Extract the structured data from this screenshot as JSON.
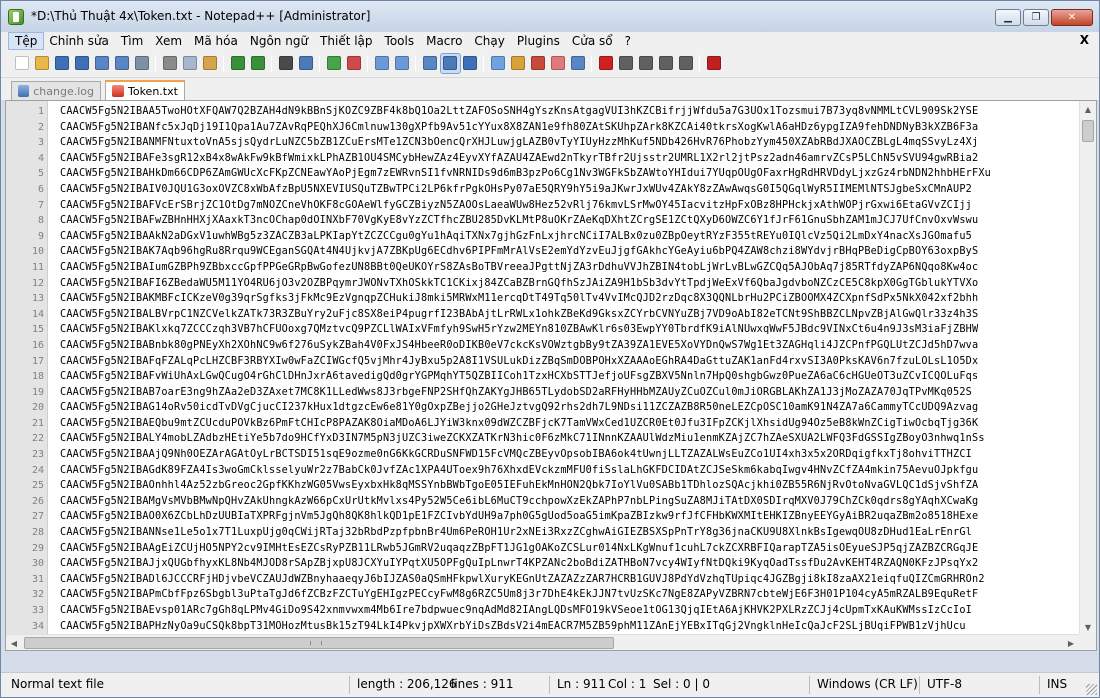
{
  "window": {
    "title": "*D:\\Thủ Thuật 4x\\Token.txt - Notepad++ [Administrator]",
    "buttons": [
      "▁",
      "❐",
      "✕"
    ]
  },
  "menu": {
    "items": [
      "Tệp",
      "Chỉnh sửa",
      "Tìm",
      "Xem",
      "Mã hóa",
      "Ngôn ngữ",
      "Thiết lập",
      "Tools",
      "Macro",
      "Chạy",
      "Plugins",
      "Cửa sổ",
      "?"
    ],
    "close": "X"
  },
  "toolbar": {
    "icons": [
      {
        "name": "new-file-icon",
        "color": "#ffffff"
      },
      {
        "name": "open-file-icon",
        "color": "#e8b84a"
      },
      {
        "name": "save-icon",
        "color": "#3f6fb6"
      },
      {
        "name": "save-all-icon",
        "color": "#3f6fb6"
      },
      {
        "name": "close-file-icon",
        "color": "#5b86c5"
      },
      {
        "name": "close-all-icon",
        "color": "#5b86c5"
      },
      {
        "name": "print-icon",
        "color": "#7f8fa6"
      },
      {
        "name": "cut-icon",
        "color": "#8a8a8a"
      },
      {
        "name": "copy-icon",
        "color": "#a6b6cf"
      },
      {
        "name": "paste-icon",
        "color": "#d7a44a"
      },
      {
        "name": "undo-icon",
        "color": "#3a8f3a"
      },
      {
        "name": "redo-icon",
        "color": "#3a8f3a"
      },
      {
        "name": "find-icon",
        "color": "#4a4a4a"
      },
      {
        "name": "replace-icon",
        "color": "#4a7ab8"
      },
      {
        "name": "zoom-in-icon",
        "color": "#4aa34a"
      },
      {
        "name": "zoom-out-icon",
        "color": "#d04a4a"
      },
      {
        "name": "sync-vertical-icon",
        "color": "#6d9ad6"
      },
      {
        "name": "sync-horizontal-icon",
        "color": "#6d9ad6"
      },
      {
        "name": "word-wrap-icon",
        "color": "#5b86c5"
      },
      {
        "name": "show-all-chars-icon",
        "color": "#4a7ab8"
      },
      {
        "name": "indent-guide-icon",
        "color": "#3f6fb6"
      },
      {
        "name": "document-map-icon",
        "color": "#6fa2e0"
      },
      {
        "name": "function-list-icon",
        "color": "#d8a23a"
      },
      {
        "name": "folder-workspace-icon",
        "color": "#c84a3a"
      },
      {
        "name": "monitoring-icon",
        "color": "#e07a7a"
      },
      {
        "name": "eye-icon",
        "color": "#5b86c5"
      },
      {
        "name": "record-macro-icon",
        "color": "#d02020"
      },
      {
        "name": "stop-recording-icon",
        "color": "#606060"
      },
      {
        "name": "play-macro-icon",
        "color": "#606060"
      },
      {
        "name": "run-macro-multiple-icon",
        "color": "#606060"
      },
      {
        "name": "save-macro-icon",
        "color": "#606060"
      },
      {
        "name": "spell-check-icon",
        "color": "#c02020"
      }
    ]
  },
  "tabs": [
    {
      "label": "change.log",
      "active": false
    },
    {
      "label": "Token.txt",
      "active": true
    }
  ],
  "editor": {
    "lines": [
      {
        "n": "1",
        "text": "CAACW5Fg5N2IBAA5TwoHOtXFQAW7Q2BZAH4dN9kBBnSjKOZC9ZBF4k8bQ1Oa2LttZAFOSoSNH4gYszKnsAtgagVUI3hKZCBifrjjWfdu5a7G3UOx1Tozsmui7B73yq8vNMMLtCVL909Sk2YSE"
      },
      {
        "n": "2",
        "text": "CAACW5Fg5N2IBANfc5xJqDj19I1Qpa1Au7ZAvRqPEQhXJ6Cmlnuw130gXPfb9Av51cYYux8X8ZAN1e9fh80ZAtSKUhpZArk8KZCAi40tkrsXogKwlA6aHDz6ypgIZA9fehDNDNyB3kXZB6F3a"
      },
      {
        "n": "3",
        "text": "CAACW5Fg5N2IBANMFNtuxtoVnA5sjsQydrLuNZC5bZB1ZCuErsMTe1ZCN3bOencQrXHJLuwjgLAZB0vTyYIUyHzzMhKuf5NDb426HvR76PhobzYym450XZAbRBdJXAOCZBLgL4mqSSvyLz4Xj"
      },
      {
        "n": "4",
        "text": "CAACW5Fg5N2IBAFe3sgR12xB4x8wAkFw9kBfWmixkLPhAZB1OU4SMCybHewZAz4EyvXYfAZAU4ZAEwd2nTkyrTBfr2Ujsstr2UMRL1X2rl2jtPsz2adn46amrvZCsP5LChN5vSVU94gwRBia2"
      },
      {
        "n": "5",
        "text": "CAACW5Fg5N2IBAHkDm66CDP6ZAmGWUcXcFKpZCNEawYAoPjEgm7zEWRvnSI1fvNRNIDs9d6mB3pzPo6Cg1Nv3WGFkSbZAWtoYHIdui7YUqpOUgOFaxrHgRdHRVDdyLjxzGz4rbNDN2hhbHErFXu"
      },
      {
        "n": "6",
        "text": "CAACW5Fg5N2IBAIV0JQU1G3oxOVZC8xWbAfzBpU5NXEVIUSQuTZBwTPCi2LP6kfrPgkOHsPy07aE5QRY9hY5i9aJKwrJxWUv4ZAkY8zZAwAwqsG0I5QGqlWyR5IIMEMlNTSJgbeSxCMnAUP2"
      },
      {
        "n": "7",
        "text": "CAACW5Fg5N2IBAFVcErSBrjZC1OtDg7mNOZCneVhOKF8cGOAeWlfyGCZBiyzN5ZAOOsLaeaWUw8Hez52vRlj76kmvLSrMwOY45IacvitzHpFxOBz8HPHckjxAthWOPjrGxwi6EtaGVvZCIjj"
      },
      {
        "n": "8",
        "text": "CAACW5Fg5N2IBAFwZBHnHHXjXAaxkT3ncOChap0dOINXbF70VgKyE8vYzZCTfhcZBU285DvKLMtP8uOKrZAeKqDXhtZCrgSE1ZCtQXyD6OWZC6Y1fJrF61GnuSbhZAM1mJCJ7UfCnvOxvWswu"
      },
      {
        "n": "9",
        "text": "CAACW5Fg5N2IBAAkN2aDGxV1uwhWBg5z3ZACZB3aLPKIapYtZCZCCgu0gYu1hAqiTXNx7gjhGzFnLxjhrcNCiI7ALBx0zu0ZBpOeytRYzF355tREYu0IQlcVz5Qi2LmDxY4nacXsJGOmafu5"
      },
      {
        "n": "10",
        "text": "CAACW5Fg5N2IBAK7Aqb96hgRu8Rrqu9WCEganSGQAt4N4UjkvjA7ZBKpUg6ECdhv6PIPFmMrAlVsE2emYdYzvEuJjgfGAkhcYGeAyiu6bPQ4ZAW8chzi8WYdvjrBHqPBeDigCpBOY63oxpByS"
      },
      {
        "n": "11",
        "text": "CAACW5Fg5N2IBAIumGZBPh9ZBbxccGpfPPGeGRpBwGofezUN8BBt0QeUKOYrS8ZAsBoTBVreeaJPgttNjZA3rDdhuVVJhZBIN4tobLjWrLvBLwGZCQq5AJObAq7j85RTfdyZAP6NQqo8Kw4oc"
      },
      {
        "n": "12",
        "text": "CAACW5Fg5N2IBAFI6ZBedaWU5M11YO4RU6jO3v2OZBPqymrJWONvTXhOSkkTC1CKixj84ZCaBZBrnGQfhSzJAiZA9H1bSb3dvYtTpdjWeExVf6QbaJgdvboNZCzCE5C8kpX0GgTGblukYTVXo"
      },
      {
        "n": "13",
        "text": "CAACW5Fg5N2IBAKMBFcICKzeV0g39qrSgfks3jFkMc9EzVgnqpZCHukiJ8mki5MRWxM11ercqDtT49Tq50lTv4VvIMcQJD2rzDqc8X3QQNLbrHu2PCiZBOOMX4ZCXpnfSdPx5NkX042xf2bhh"
      },
      {
        "n": "14",
        "text": "CAACW5Fg5N2IBALBVrpC1NZCVelkZATk73R3ZBuYry2uFjc8SX8eiP4pugrfI23BAbAjtLrRWLx1ohkZBeKd9GksxZCYrbCVNYuZBj7VD9oAbI82eTCNt9ShBBZCLNpvZBjAlGwQlr33z4h3S"
      },
      {
        "n": "15",
        "text": "CAACW5Fg5N2IBAKlxkq7ZCCCzqh3VB7hCFUOoxg7QMztvcQ9PZCLlWAIxVFmfyh9SwH5rYzw2MEYn810ZBAwKlr6s03EwpYY0TbrdfK9iAlNUwxqWwF5JBdc9VINxCt6u4n9J3sM3iaFjZBHW"
      },
      {
        "n": "16",
        "text": "CAACW5Fg5N2IBABnbk80gPNEyXh2XOhNC9w6f276uSykZBah4V0FxJS4HbeeR0oDIKB0eV7ckcKsVOWztgbBy9tZA39ZA1EVE5XoVYDnQwS7Wg1Et3ZAGHqli4JZCPnfPGQLUtZCJd5hD7wva"
      },
      {
        "n": "17",
        "text": "CAACW5Fg5N2IBAFqFZALqPcLHZCBF3RBYXIw0wFaZCIWGcfQ5vjMhr4JyBxu5p2A8I1VSULukDizZBqSmDOBPOHxXZAAAoEGhRA4DaGttuZAK1anFd4rxvSI3A0PksKAV6n7fzuLOLsL1O5Dx"
      },
      {
        "n": "18",
        "text": "CAACW5Fg5N2IBAFvWiUhAxLGwQCugO4rGhClDHnJxrA6tavedigQd0grYGPMqhYT5QZBIICoh1TzxHCXbSTTJefjoUFsgZBXV5Nnln7HpQ0shgbGwz0PueZA6aC6cHGUeOT3uZCvICQOLuFqs"
      },
      {
        "n": "19",
        "text": "CAACW5Fg5N2IBAB7oarE3ng9hZAa2eD3ZAxet7MC8K1LLedWws8J3rbgeFNP2SHfQhZAKYgJHB65TLydobSD2aRFHyHHbMZAUyZCuOZCul0mJiORGBLAKhZA1J3jMoZAZA70JqTPvMKq052S"
      },
      {
        "n": "20",
        "text": "CAACW5Fg5N2IBAG14oRv50icdTvDVgCjucCI237kHux1dtgzcEw6e81Y0gOxpZBejjo2GHeJztvgQ92rhs2dh7L9NDsi11ZCZAZB8R50neLEZCpOSC10amK91N4ZA7a6CammyTCcUDQ9Azvag"
      },
      {
        "n": "21",
        "text": "CAACW5Fg5N2IBAEQbu9mtZCUcduPOVkBz6PmFtCHIcP8PAZAK8OiaMDoA6LJYiW3knx09dWZCZBFjcK7TamVWxCed1UZCR0Et0Jfu3IFpZCKjlXhsidUg94Oz5eB8kWnZCigTiwOcbqTjg36K"
      },
      {
        "n": "22",
        "text": "CAACW5Fg5N2IBALY4mobLZAdbzHEtiYe5b7do9HCfYxD3IN7M5pN3jUZC3iweZCKXZATKrN3hic0F6zMkC71INnnKZAAUlWdzMiu1enmKZAjZC7hZAeSXUA2LWFQ3FdGSSIgZBoyO3nhwq1nSs"
      },
      {
        "n": "23",
        "text": "CAACW5Fg5N2IBAAjQ9Nh0OEZArAGAtOyLrBCTSDI51sqE9ozme0nG6KkGCRDuSNFWD15FcVMQcZBEyvOpsobIBA6ok4tUwnjLLTZAZALWsEuZCo1UI4xh3x5x2ORDqigfkxTj8ohviTTHZCI"
      },
      {
        "n": "24",
        "text": "CAACW5Fg5N2IBAGdK89FZA4Is3woGmCklsselyuWr2z7BabCk0JvfZAc1XPA4UToex9h76XhxdEVckzmMFU0fiSslaLhGKFDCIDAtZCJSeSkm6kabqIwgv4HNvZCfZA4mkin75AevuOJpkfgu"
      },
      {
        "n": "25",
        "text": "CAACW5Fg5N2IBAOnhhl4Az52zbGreoc2GpfKKhzWG05VwsEyxbxHk8qMSSYnbBWbTgoE05IEFuhEkMnHON2Qbk7IoYlVu0SABb1TDhlozSQAcjkhi0ZB55R6NjRvOtoNvaGVLQC1dSjvShfZA"
      },
      {
        "n": "26",
        "text": "CAACW5Fg5N2IBAMgVsMVbBMwNpQHvZAkUhngkAzW66pCxUrUtkMvlxs4Py52W5Ce6ibL6MuCT9cchpowXzEkZAPhP7nbLPingSuZA8MJiTAtDX0SDIrqMXV0J79ChZCk0qdrs8gYAqhXCwaKg"
      },
      {
        "n": "27",
        "text": "CAACW5Fg5N2IBAO0X6ZCbLhDzUUBIaTXPRFgjnVm5JgQh8QK8hlkQD1pE1FZCIvbYdUH9a7ph0G5gUod5oaG5imKpaZBIzkw9rfJfCFHbKWXMItEHKIZBnyEEYGyAiBR2uqaZBm2o8518HExe"
      },
      {
        "n": "28",
        "text": "CAACW5Fg5N2IBANNse1Le5o1x7T1LuxpUjg0qCWijRTaj32bRbdPzpfpbnBr4Um6PeROH1Ur2xNEi3RxzZCghwAiGIEZBSXSpPnTrY8g36jnaCKU9U8XlnkBsIgewqOU8zDHud1EaLrEnrGl"
      },
      {
        "n": "29",
        "text": "CAACW5Fg5N2IBAAgEiZCUjHO5NPY2cv9IMHtEsEZCsRyPZB11LRwb5JGmRV2uqaqzZBpFT1JG1gOAKoZCSLur014NxLKgWnuf1cuhL7ckZCXRBFIQarapTZA5isOEyueSJP5qjZAZBZCRGqJE"
      },
      {
        "n": "30",
        "text": "CAACW5Fg5N2IBAJjxQUGbfhyxKL8Nb4MJOD8rSApZBjxpU8JCXYuIYPqtXU5OPFgQuIpLnwrT4KPZANc2boBdiZATHBoN7vcy4WIyfNtDQki9KyqOadTssfDu2AvKEHT4RZAQN0KFzJPsqYx2"
      },
      {
        "n": "31",
        "text": "CAACW5Fg5N2IBADl6JCCCRFjHDjvbeVCZAUJdWZBnyhaaeqyJ6bIJZAS0aQSmHFkpwlXuryKEGnUtZAZAZzZAR7HCRB1GUVJ8PdYdVzhqTUpiqc4JGZBgji8kI8zaAX21eiqfuQIZCmGRHROn2"
      },
      {
        "n": "32",
        "text": "CAACW5Fg5N2IBAPmCbfFpz6Sbgbl3uPtaTgJd6fZCBzFZCTuYgEHIgzPECcyFwM8g6RZC5Um8j3r7DhE4kEkJJN7tvUzSKc7NgE8ZAPyVZBRN7cbteWjE6F3H01P104cyA5mRZALB9EquRetF"
      },
      {
        "n": "33",
        "text": "CAACW5Fg5N2IBAEvsp01ARc7gGh8qLPMv4GiDo9S42xnmvwxm4Mb6Ire7bdpwuec9nqAdMd82IAngLQDsMFO19kVSeoe1tOG13QjqIEtA6AjKHVK2PXLRzZCJj4cUpmTxKAuKWMssIzCcIoI"
      },
      {
        "n": "34",
        "text": "CAACW5Fg5N2IBAPHzNyOa9uCSQk8bpT31MOHozMtusBk15zT94LkI4PkvjpXWXrbYiDsZBdsV2i4mEACR7M5ZB59phM11ZAnEjYEBxITqGj2VngklnHeIcQaJcF2SLjBUqiFPWB1zVjhUcu"
      }
    ]
  },
  "status": {
    "file_type": "Normal text file",
    "length": "length : 206,126",
    "lines": "lines : 911",
    "ln": "Ln : 911",
    "col": "Col : 1",
    "sel": "Sel : 0 | 0",
    "eol": "Windows (CR LF)",
    "encoding": "UTF-8",
    "mode": "INS"
  },
  "colors": {
    "active_tab_accent": "#f2a34a",
    "gutter": "#e4e4e4",
    "line_number": "#808080"
  }
}
